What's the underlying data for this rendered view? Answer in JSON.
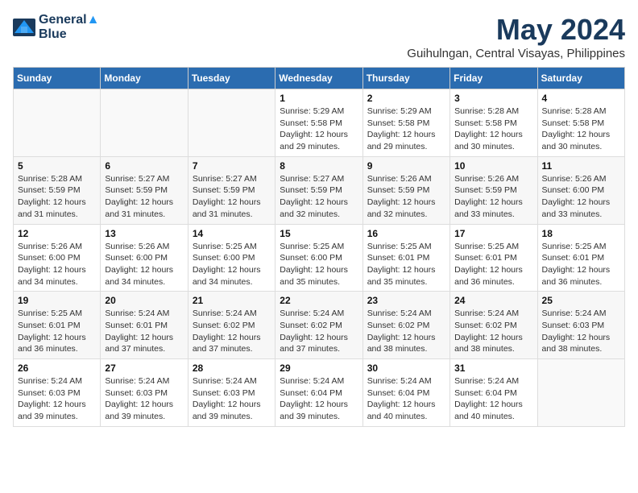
{
  "logo": {
    "line1": "General",
    "line2": "Blue"
  },
  "title": "May 2024",
  "subtitle": "Guihulngan, Central Visayas, Philippines",
  "headers": [
    "Sunday",
    "Monday",
    "Tuesday",
    "Wednesday",
    "Thursday",
    "Friday",
    "Saturday"
  ],
  "weeks": [
    [
      {
        "day": "",
        "info": ""
      },
      {
        "day": "",
        "info": ""
      },
      {
        "day": "",
        "info": ""
      },
      {
        "day": "1",
        "info": "Sunrise: 5:29 AM\nSunset: 5:58 PM\nDaylight: 12 hours\nand 29 minutes."
      },
      {
        "day": "2",
        "info": "Sunrise: 5:29 AM\nSunset: 5:58 PM\nDaylight: 12 hours\nand 29 minutes."
      },
      {
        "day": "3",
        "info": "Sunrise: 5:28 AM\nSunset: 5:58 PM\nDaylight: 12 hours\nand 30 minutes."
      },
      {
        "day": "4",
        "info": "Sunrise: 5:28 AM\nSunset: 5:58 PM\nDaylight: 12 hours\nand 30 minutes."
      }
    ],
    [
      {
        "day": "5",
        "info": "Sunrise: 5:28 AM\nSunset: 5:59 PM\nDaylight: 12 hours\nand 31 minutes."
      },
      {
        "day": "6",
        "info": "Sunrise: 5:27 AM\nSunset: 5:59 PM\nDaylight: 12 hours\nand 31 minutes."
      },
      {
        "day": "7",
        "info": "Sunrise: 5:27 AM\nSunset: 5:59 PM\nDaylight: 12 hours\nand 31 minutes."
      },
      {
        "day": "8",
        "info": "Sunrise: 5:27 AM\nSunset: 5:59 PM\nDaylight: 12 hours\nand 32 minutes."
      },
      {
        "day": "9",
        "info": "Sunrise: 5:26 AM\nSunset: 5:59 PM\nDaylight: 12 hours\nand 32 minutes."
      },
      {
        "day": "10",
        "info": "Sunrise: 5:26 AM\nSunset: 5:59 PM\nDaylight: 12 hours\nand 33 minutes."
      },
      {
        "day": "11",
        "info": "Sunrise: 5:26 AM\nSunset: 6:00 PM\nDaylight: 12 hours\nand 33 minutes."
      }
    ],
    [
      {
        "day": "12",
        "info": "Sunrise: 5:26 AM\nSunset: 6:00 PM\nDaylight: 12 hours\nand 34 minutes."
      },
      {
        "day": "13",
        "info": "Sunrise: 5:26 AM\nSunset: 6:00 PM\nDaylight: 12 hours\nand 34 minutes."
      },
      {
        "day": "14",
        "info": "Sunrise: 5:25 AM\nSunset: 6:00 PM\nDaylight: 12 hours\nand 34 minutes."
      },
      {
        "day": "15",
        "info": "Sunrise: 5:25 AM\nSunset: 6:00 PM\nDaylight: 12 hours\nand 35 minutes."
      },
      {
        "day": "16",
        "info": "Sunrise: 5:25 AM\nSunset: 6:01 PM\nDaylight: 12 hours\nand 35 minutes."
      },
      {
        "day": "17",
        "info": "Sunrise: 5:25 AM\nSunset: 6:01 PM\nDaylight: 12 hours\nand 36 minutes."
      },
      {
        "day": "18",
        "info": "Sunrise: 5:25 AM\nSunset: 6:01 PM\nDaylight: 12 hours\nand 36 minutes."
      }
    ],
    [
      {
        "day": "19",
        "info": "Sunrise: 5:25 AM\nSunset: 6:01 PM\nDaylight: 12 hours\nand 36 minutes."
      },
      {
        "day": "20",
        "info": "Sunrise: 5:24 AM\nSunset: 6:01 PM\nDaylight: 12 hours\nand 37 minutes."
      },
      {
        "day": "21",
        "info": "Sunrise: 5:24 AM\nSunset: 6:02 PM\nDaylight: 12 hours\nand 37 minutes."
      },
      {
        "day": "22",
        "info": "Sunrise: 5:24 AM\nSunset: 6:02 PM\nDaylight: 12 hours\nand 37 minutes."
      },
      {
        "day": "23",
        "info": "Sunrise: 5:24 AM\nSunset: 6:02 PM\nDaylight: 12 hours\nand 38 minutes."
      },
      {
        "day": "24",
        "info": "Sunrise: 5:24 AM\nSunset: 6:02 PM\nDaylight: 12 hours\nand 38 minutes."
      },
      {
        "day": "25",
        "info": "Sunrise: 5:24 AM\nSunset: 6:03 PM\nDaylight: 12 hours\nand 38 minutes."
      }
    ],
    [
      {
        "day": "26",
        "info": "Sunrise: 5:24 AM\nSunset: 6:03 PM\nDaylight: 12 hours\nand 39 minutes."
      },
      {
        "day": "27",
        "info": "Sunrise: 5:24 AM\nSunset: 6:03 PM\nDaylight: 12 hours\nand 39 minutes."
      },
      {
        "day": "28",
        "info": "Sunrise: 5:24 AM\nSunset: 6:03 PM\nDaylight: 12 hours\nand 39 minutes."
      },
      {
        "day": "29",
        "info": "Sunrise: 5:24 AM\nSunset: 6:04 PM\nDaylight: 12 hours\nand 39 minutes."
      },
      {
        "day": "30",
        "info": "Sunrise: 5:24 AM\nSunset: 6:04 PM\nDaylight: 12 hours\nand 40 minutes."
      },
      {
        "day": "31",
        "info": "Sunrise: 5:24 AM\nSunset: 6:04 PM\nDaylight: 12 hours\nand 40 minutes."
      },
      {
        "day": "",
        "info": ""
      }
    ]
  ]
}
